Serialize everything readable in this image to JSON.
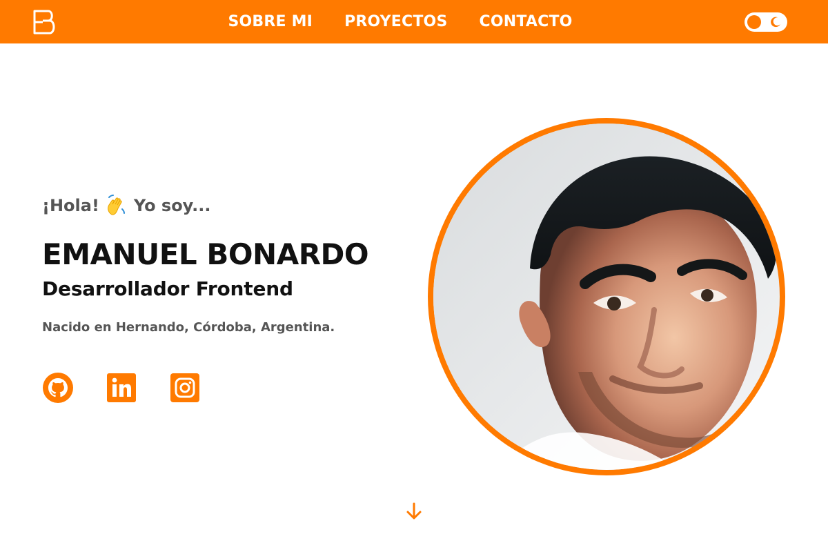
{
  "header": {
    "nav": [
      {
        "label": "SOBRE MI"
      },
      {
        "label": "PROYECTOS"
      },
      {
        "label": "CONTACTO"
      }
    ],
    "accent": "#ff7a00",
    "logo_icon": "eb-monogram-logo-icon",
    "theme_toggle_icon": "moon-icon"
  },
  "hero": {
    "greeting_pre": "¡Hola!",
    "greeting_post": "Yo soy...",
    "greeting_icon": "waving-hand-icon",
    "name": "EMANUEL BONARDO",
    "role": "Desarrollador Frontend",
    "bio": "Nacido en Hernando, Córdoba, Argentina.",
    "social": [
      {
        "icon": "github-icon"
      },
      {
        "icon": "linkedin-icon"
      },
      {
        "icon": "instagram-icon"
      }
    ],
    "photo": {
      "ring_color": "#ff7a00"
    },
    "scroll_icon": "arrow-down-icon"
  }
}
